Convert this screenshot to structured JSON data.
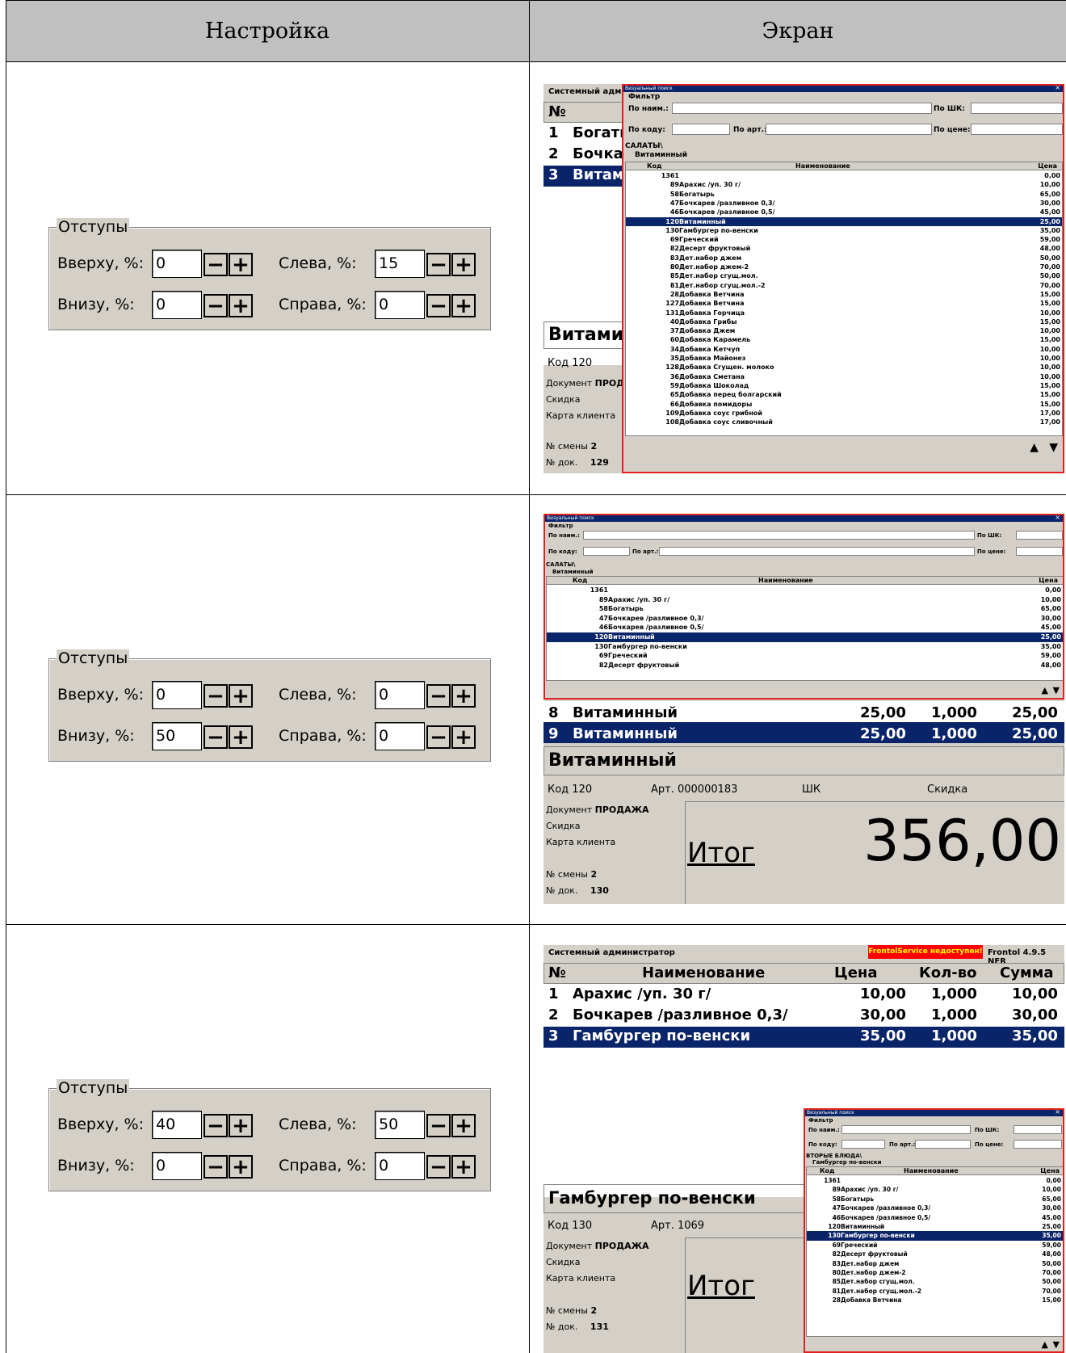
{
  "table": {
    "col_settings": "Настройка",
    "col_screen": "Экран"
  },
  "settings": [
    {
      "group_title": "Отступы",
      "top_label": "Вверху, %:",
      "top_value": "0",
      "left_label": "Слева, %:",
      "left_value": "15",
      "bottom_label": "Внизу, %:",
      "bottom_value": "0",
      "right_label": "Справа, %:",
      "right_value": "0",
      "minus": "−",
      "plus": "+"
    },
    {
      "group_title": "Отступы",
      "top_label": "Вверху, %:",
      "top_value": "0",
      "left_label": "Слева, %:",
      "left_value": "0",
      "bottom_label": "Внизу, %:",
      "bottom_value": "50",
      "right_label": "Справа, %:",
      "right_value": "0",
      "minus": "−",
      "plus": "+"
    },
    {
      "group_title": "Отступы",
      "top_label": "Вверху, %:",
      "top_value": "40",
      "left_label": "Слева, %:",
      "left_value": "50",
      "bottom_label": "Внизу, %:",
      "bottom_value": "0",
      "right_label": "Справа, %:",
      "right_value": "0",
      "minus": "−",
      "plus": "+"
    }
  ],
  "popup": {
    "title": "Визуальный поиск",
    "filter": "Фильтр",
    "by_name": "По наим.:",
    "by_code": "По коду:",
    "by_art": "По арт.:",
    "by_barcode": "По ШК:",
    "by_price": "По цене:",
    "col_code": "Код",
    "col_name": "Наименование",
    "col_price": "Цена",
    "path1_a": "САЛАТЫ\\",
    "path1_b": "Витаминный",
    "path3_a": "ВТОРЫЕ БЛЮДА\\",
    "path3_b": "Гамбургер по-венски",
    "close": "×",
    "items": [
      {
        "code": "1361",
        "name": "",
        "price": "0,00"
      },
      {
        "code": "89",
        "name": "Арахис /уп. 30 г/",
        "price": "10,00"
      },
      {
        "code": "58",
        "name": "Богатырь",
        "price": "65,00"
      },
      {
        "code": "47",
        "name": "Бочкарев /разливное 0,3/",
        "price": "30,00"
      },
      {
        "code": "46",
        "name": "Бочкарев /разливное 0,5/",
        "price": "45,00"
      },
      {
        "code": "120",
        "name": "Витаминный",
        "price": "25,00"
      },
      {
        "code": "130",
        "name": "Гамбургер по-венски",
        "price": "35,00"
      },
      {
        "code": "69",
        "name": "Греческий",
        "price": "59,00"
      },
      {
        "code": "82",
        "name": "Десерт фруктовый",
        "price": "48,00"
      },
      {
        "code": "83",
        "name": "Дет.набор джем",
        "price": "50,00"
      },
      {
        "code": "80",
        "name": "Дет.набор джем-2",
        "price": "70,00"
      },
      {
        "code": "85",
        "name": "Дет.набор сгущ.мол.",
        "price": "50,00"
      },
      {
        "code": "81",
        "name": "Дет.набор сгущ.мол.-2",
        "price": "70,00"
      },
      {
        "code": "28",
        "name": "Добавка Ветчина",
        "price": "15,00"
      },
      {
        "code": "127",
        "name": "Добавка Ветчина",
        "price": "15,00"
      },
      {
        "code": "131",
        "name": "Добавка Горчица",
        "price": "10,00"
      },
      {
        "code": "40",
        "name": "Добавка Грибы",
        "price": "15,00"
      },
      {
        "code": "37",
        "name": "Добавка Джем",
        "price": "10,00"
      },
      {
        "code": "60",
        "name": "Добавка Карамель",
        "price": "15,00"
      },
      {
        "code": "34",
        "name": "Добавка Кетчуп",
        "price": "10,00"
      },
      {
        "code": "35",
        "name": "Добавка Майонез",
        "price": "10,00"
      },
      {
        "code": "128",
        "name": "Добавка Сгущен. молоко",
        "price": "10,00"
      },
      {
        "code": "36",
        "name": "Добавка Сметана",
        "price": "10,00"
      },
      {
        "code": "59",
        "name": "Добавка Шоколад",
        "price": "15,00"
      },
      {
        "code": "65",
        "name": "Добавка перец болгарский",
        "price": "15,00"
      },
      {
        "code": "66",
        "name": "Добавка помидоры",
        "price": "15,00"
      },
      {
        "code": "109",
        "name": "Добавка соус грибной",
        "price": "17,00"
      },
      {
        "code": "108",
        "name": "Добавка соус сливочный",
        "price": "17,00"
      }
    ]
  },
  "screen1": {
    "header": "Системный админ",
    "num_col": "№",
    "rows": [
      {
        "n": "1",
        "name": "Богать"
      },
      {
        "n": "2",
        "name": "Бочкар"
      },
      {
        "n": "3",
        "name": "Витами"
      }
    ],
    "big_name": "Витамин",
    "code": "Код 120",
    "doc_label": "Документ",
    "doc_value": "ПРОД",
    "discount": "Скидка",
    "card": "Карта клиента",
    "shift_label": "№ смены",
    "shift_value": "2",
    "doc_num_label": "№ док.",
    "doc_num_value": "129"
  },
  "screen2": {
    "rows": [
      {
        "n": "8",
        "name": "Витаминный",
        "price": "25,00",
        "qty": "1,000",
        "sum": "25,00"
      },
      {
        "n": "9",
        "name": "Витаминный",
        "price": "25,00",
        "qty": "1,000",
        "sum": "25,00"
      }
    ],
    "big_name": "Витаминный",
    "code": "Код 120",
    "art": "Арт. 000000183",
    "barcode": "ШК",
    "discount_hdr": "Скидка",
    "doc_label": "Документ",
    "doc_value": "ПРОДАЖА",
    "discount": "Скидка",
    "card": "Карта клиента",
    "shift_label": "№ смены",
    "shift_value": "2",
    "doc_num_label": "№ док.",
    "doc_num_value": "130",
    "total_label": "Итог",
    "total_value": "356,00"
  },
  "screen3": {
    "header": "Системный администратор",
    "service_alert": "FrontolService недоступен!",
    "version": "Frontol 4.9.5 NFR",
    "cols": {
      "num": "№",
      "name": "Наименование",
      "price": "Цена",
      "qty": "Кол-во",
      "sum": "Сумма"
    },
    "rows": [
      {
        "n": "1",
        "name": "Арахис /уп. 30 г/",
        "price": "10,00",
        "qty": "1,000",
        "sum": "10,00"
      },
      {
        "n": "2",
        "name": "Бочкарев /разливное 0,3/",
        "price": "30,00",
        "qty": "1,000",
        "sum": "30,00"
      },
      {
        "n": "3",
        "name": "Гамбургер по-венски",
        "price": "35,00",
        "qty": "1,000",
        "sum": "35,00"
      }
    ],
    "big_name": "Гамбургер по-венски",
    "code": "Код 130",
    "art": "Арт. 1069",
    "doc_label": "Документ",
    "doc_value": "ПРОДАЖА",
    "discount": "Скидка",
    "card": "Карта клиента",
    "shift_label": "№ смены",
    "shift_value": "2",
    "doc_num_label": "№ док.",
    "doc_num_value": "131",
    "total_label": "Итог"
  },
  "colors": {
    "selection": "#0a246a",
    "popup_border": "#e02020",
    "window": "#d4d0c8",
    "alert": "#ff0000"
  }
}
